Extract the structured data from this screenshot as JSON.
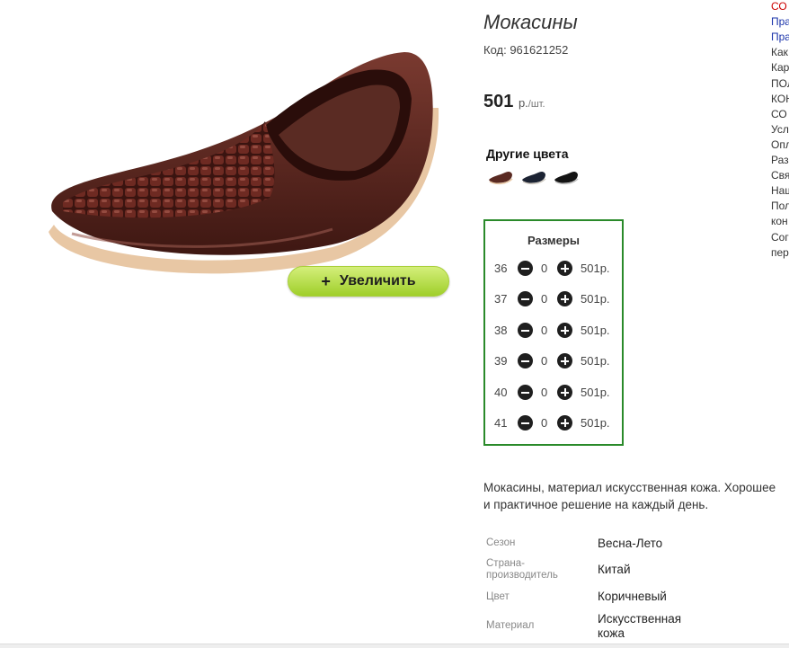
{
  "product": {
    "title": "Мокасины",
    "code": "Код: 961621252",
    "price_value": "501",
    "price_unit": "р.",
    "price_per": "/шт.",
    "zoom_label": "Увеличить",
    "zoom_plus": "+"
  },
  "other_colors": {
    "title": "Другие цвета",
    "swatches": [
      {
        "name": "brown",
        "color": "#5a2a22"
      },
      {
        "name": "navy",
        "color": "#1c2333"
      },
      {
        "name": "black",
        "color": "#141414"
      }
    ]
  },
  "sizes": {
    "title": "Размеры",
    "rows": [
      {
        "size": "36",
        "qty": "0",
        "price": "501р."
      },
      {
        "size": "37",
        "qty": "0",
        "price": "501р."
      },
      {
        "size": "38",
        "qty": "0",
        "price": "501р."
      },
      {
        "size": "39",
        "qty": "0",
        "price": "501р."
      },
      {
        "size": "40",
        "qty": "0",
        "price": "501р."
      },
      {
        "size": "41",
        "qty": "0",
        "price": "501р."
      }
    ]
  },
  "description": {
    "line1": "Мокасины, материал искусственная кожа. Хорошее",
    "line2": "и практичное решение на каждый день."
  },
  "attributes": [
    {
      "label": "Сезон",
      "value": "Весна-Лето"
    },
    {
      "label": "Страна-\nпроизводитель",
      "value": "Китай"
    },
    {
      "label": "Цвет",
      "value": "Коричневый"
    },
    {
      "label": "Материал",
      "value": "Искусственная\nкожа"
    }
  ],
  "right_menu": [
    {
      "text": "СО",
      "color": "#cc0000"
    },
    {
      "text": "Пра",
      "color": "#1a33aa"
    },
    {
      "text": "Пра",
      "color": "#1a33aa"
    },
    {
      "text": "Как",
      "color": "#333333"
    },
    {
      "text": "Кар",
      "color": "#333333"
    },
    {
      "text": "ПОЛ",
      "color": "#333333"
    },
    {
      "text": "КОН",
      "color": "#333333"
    },
    {
      "text": "СО",
      "color": "#333333"
    },
    {
      "text": "Усл",
      "color": "#333333"
    },
    {
      "text": "Опл",
      "color": "#333333"
    },
    {
      "text": "Раз",
      "color": "#333333"
    },
    {
      "text": "Свя",
      "color": "#333333"
    },
    {
      "text": "Наш",
      "color": "#333333"
    },
    {
      "text": "Пол",
      "color": "#333333"
    },
    {
      "text": "кон",
      "color": "#333333"
    },
    {
      "text": "Сог",
      "color": "#333333"
    },
    {
      "text": "пер",
      "color": "#333333"
    }
  ]
}
